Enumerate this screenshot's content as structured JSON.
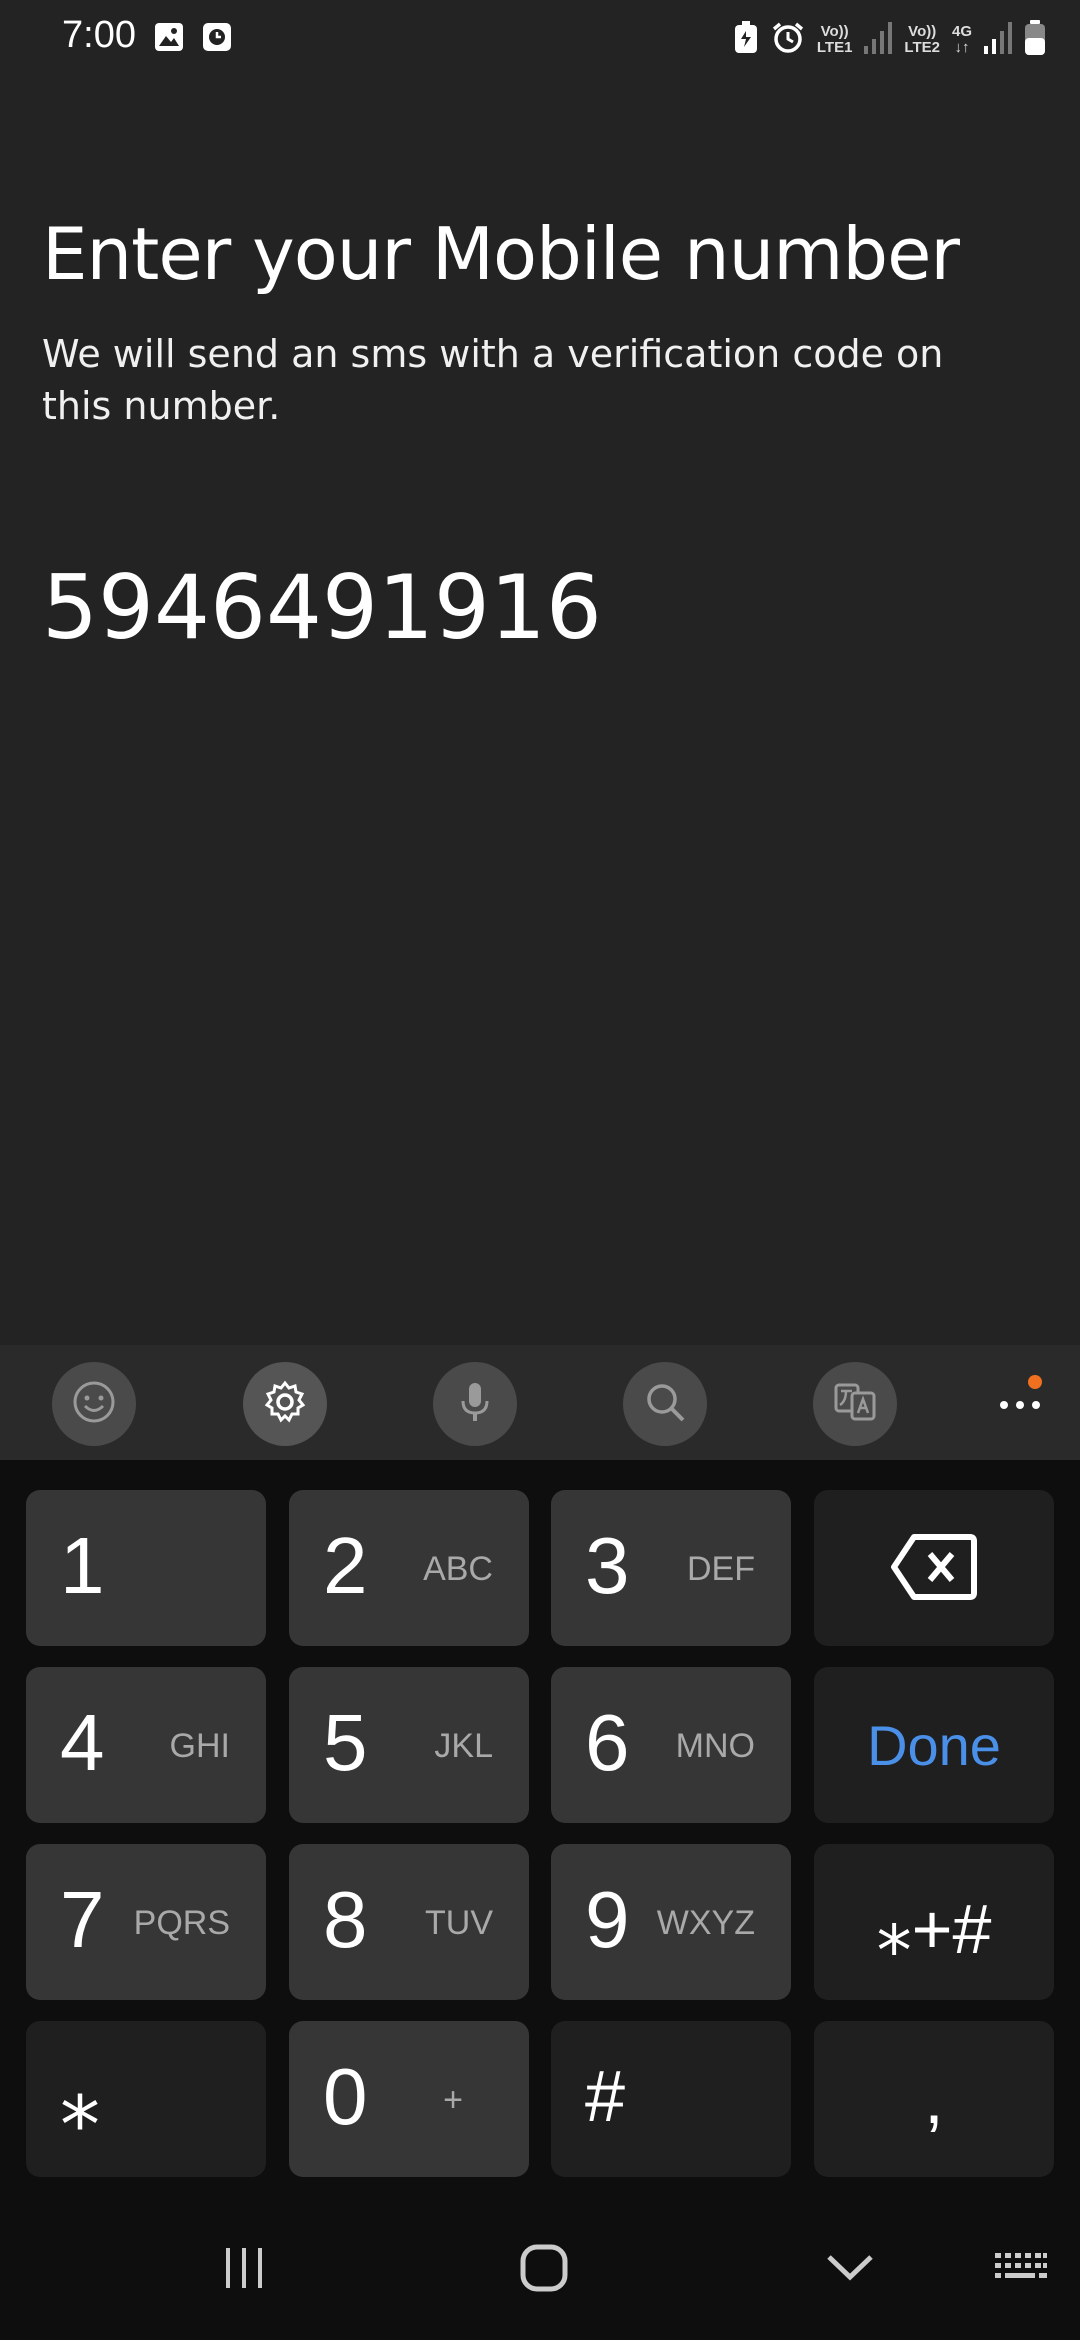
{
  "status_bar": {
    "time": "7:00",
    "icons_left": [
      "gallery-icon",
      "screen-time-icon"
    ],
    "sim1_label_top": "Vo))",
    "sim1_label_bottom": "LTE1",
    "sim2_label_top": "Vo))",
    "sim2_label_bottom": "LTE2",
    "network_type": "4G"
  },
  "page": {
    "title": "Enter your Mobile number",
    "subtitle": "We will send an sms with a verification code on this number.",
    "phone_value": "5946491916"
  },
  "toolbar": {
    "items": [
      "emoji-icon",
      "settings-icon",
      "mic-icon",
      "search-icon",
      "translate-icon",
      "more-icon"
    ],
    "accent": "#f07020"
  },
  "keyboard": {
    "keys": [
      {
        "num": "1",
        "letters": ""
      },
      {
        "num": "2",
        "letters": "ABC"
      },
      {
        "num": "3",
        "letters": "DEF"
      },
      {
        "num": "4",
        "letters": "GHI"
      },
      {
        "num": "5",
        "letters": "JKL"
      },
      {
        "num": "6",
        "letters": "MNO"
      },
      {
        "num": "7",
        "letters": "PQRS"
      },
      {
        "num": "8",
        "letters": "TUV"
      },
      {
        "num": "9",
        "letters": "WXYZ"
      },
      {
        "num": "0",
        "letters": "+"
      }
    ],
    "done_label": "Done",
    "symbols_label": "⁎+#",
    "star_label": "⁎",
    "hash_label": "#",
    "comma_label": ",",
    "done_color": "#4a90e8"
  }
}
